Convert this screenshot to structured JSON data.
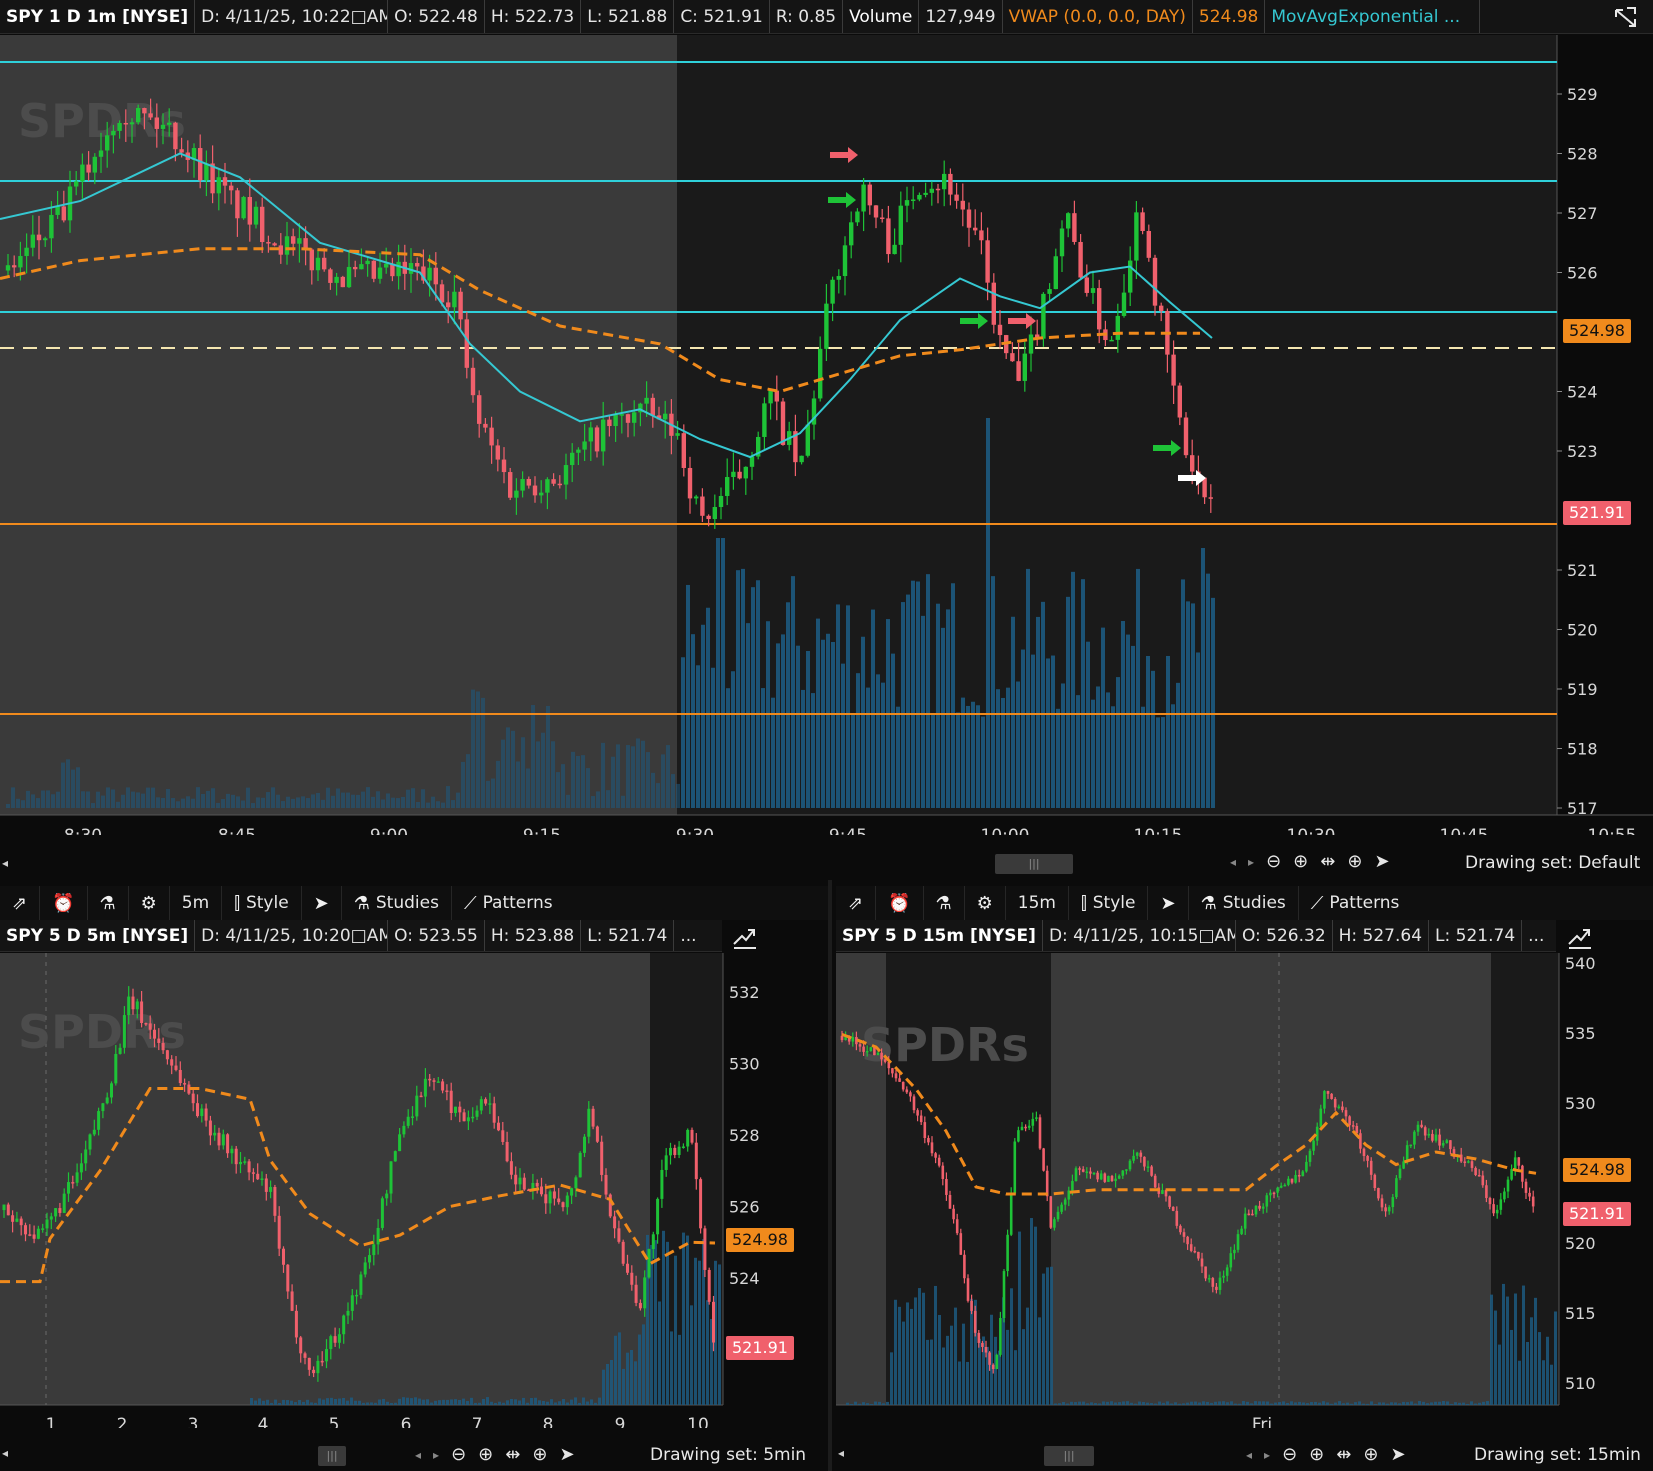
{
  "main": {
    "header": {
      "symbol": "SPY 1 D 1m [NYSE]",
      "date": "D: 4/11/25, 10:22□AM",
      "open": "O: 522.48",
      "high": "H: 522.73",
      "low": "L: 521.88",
      "close": "C: 521.91",
      "range": "R: 0.85",
      "volume_label": "Volume",
      "volume_value": "127,949",
      "vwap_label": "VWAP (0.0, 0.0, DAY)",
      "vwap_value": "524.98",
      "ema_label": "MovAvgExponential ..."
    },
    "price_ticks": [
      "529",
      "528",
      "527",
      "526",
      "524",
      "523",
      "521",
      "520",
      "519",
      "518",
      "517"
    ],
    "time_ticks": [
      "8:30",
      "8:45",
      "9:00",
      "9:15",
      "9:30",
      "9:45",
      "10:00",
      "10:15",
      "10:30",
      "10:45",
      "10:55"
    ],
    "vwap_badge": "524.98",
    "last_badge": "521.91",
    "drawing_set": "Drawing set: Default"
  },
  "left": {
    "toolbar": {
      "aggregation": "5m",
      "style": "Style",
      "studies": "Studies",
      "patterns": "Patterns"
    },
    "header": {
      "symbol": "SPY 5 D 5m [NYSE]",
      "date": "D: 4/11/25, 10:20□AM",
      "open": "O: 523.55",
      "high": "H: 523.88",
      "low": "L: 521.74",
      "more": "..."
    },
    "price_ticks": [
      "532",
      "530",
      "528",
      "526",
      "524"
    ],
    "day_ticks": [
      "1",
      "2",
      "3",
      "4",
      "5",
      "6",
      "7",
      "8",
      "9",
      "10"
    ],
    "vwap_badge": "524.98",
    "last_badge": "521.91",
    "drawing_set": "Drawing set: 5min"
  },
  "right": {
    "toolbar": {
      "aggregation": "15m",
      "style": "Style",
      "studies": "Studies",
      "patterns": "Patterns"
    },
    "header": {
      "symbol": "SPY 5 D 15m [NYSE]",
      "date": "D: 4/11/25, 10:15□AM",
      "open": "O: 526.32",
      "high": "H: 527.64",
      "low": "L: 521.74",
      "more": "..."
    },
    "price_ticks": [
      "540",
      "535",
      "530",
      "520",
      "515",
      "510"
    ],
    "day_tick": "Fri",
    "vwap_badge": "524.98",
    "last_badge": "521.91",
    "drawing_set": "Drawing set: 15min"
  },
  "watermark": "SPDRs",
  "colors": {
    "up": "#1ec337",
    "down": "#f0606c",
    "ema": "#35c8d2",
    "vwap": "#f08a1c",
    "level_cyan": "#2fd0da",
    "level_orange": "#f08a1c",
    "volume": "#1d5a80",
    "premarket_bg": "#3a3a3a",
    "session_bg": "#1a1a1a"
  },
  "chart_data": [
    {
      "type": "candlestick",
      "title": "SPY 1 D 1m [NYSE]",
      "ylim": [
        516.9,
        530.2
      ],
      "x_range": [
        "8:24",
        "10:55"
      ],
      "levels": [
        529.5,
        527.5,
        525.3,
        524.7,
        521.81,
        518.6
      ],
      "vwap_last": 524.98,
      "last": 521.91
    },
    {
      "type": "candlestick",
      "title": "SPY 5 D 5m [NYSE]",
      "ylim": [
        520.4,
        533.3
      ],
      "last": 521.91,
      "vwap_last": 524.98
    },
    {
      "type": "candlestick",
      "title": "SPY 5 D 15m [NYSE]",
      "ylim": [
        508.3,
        540.0
      ],
      "last": 521.91,
      "vwap_last": 524.98
    }
  ]
}
